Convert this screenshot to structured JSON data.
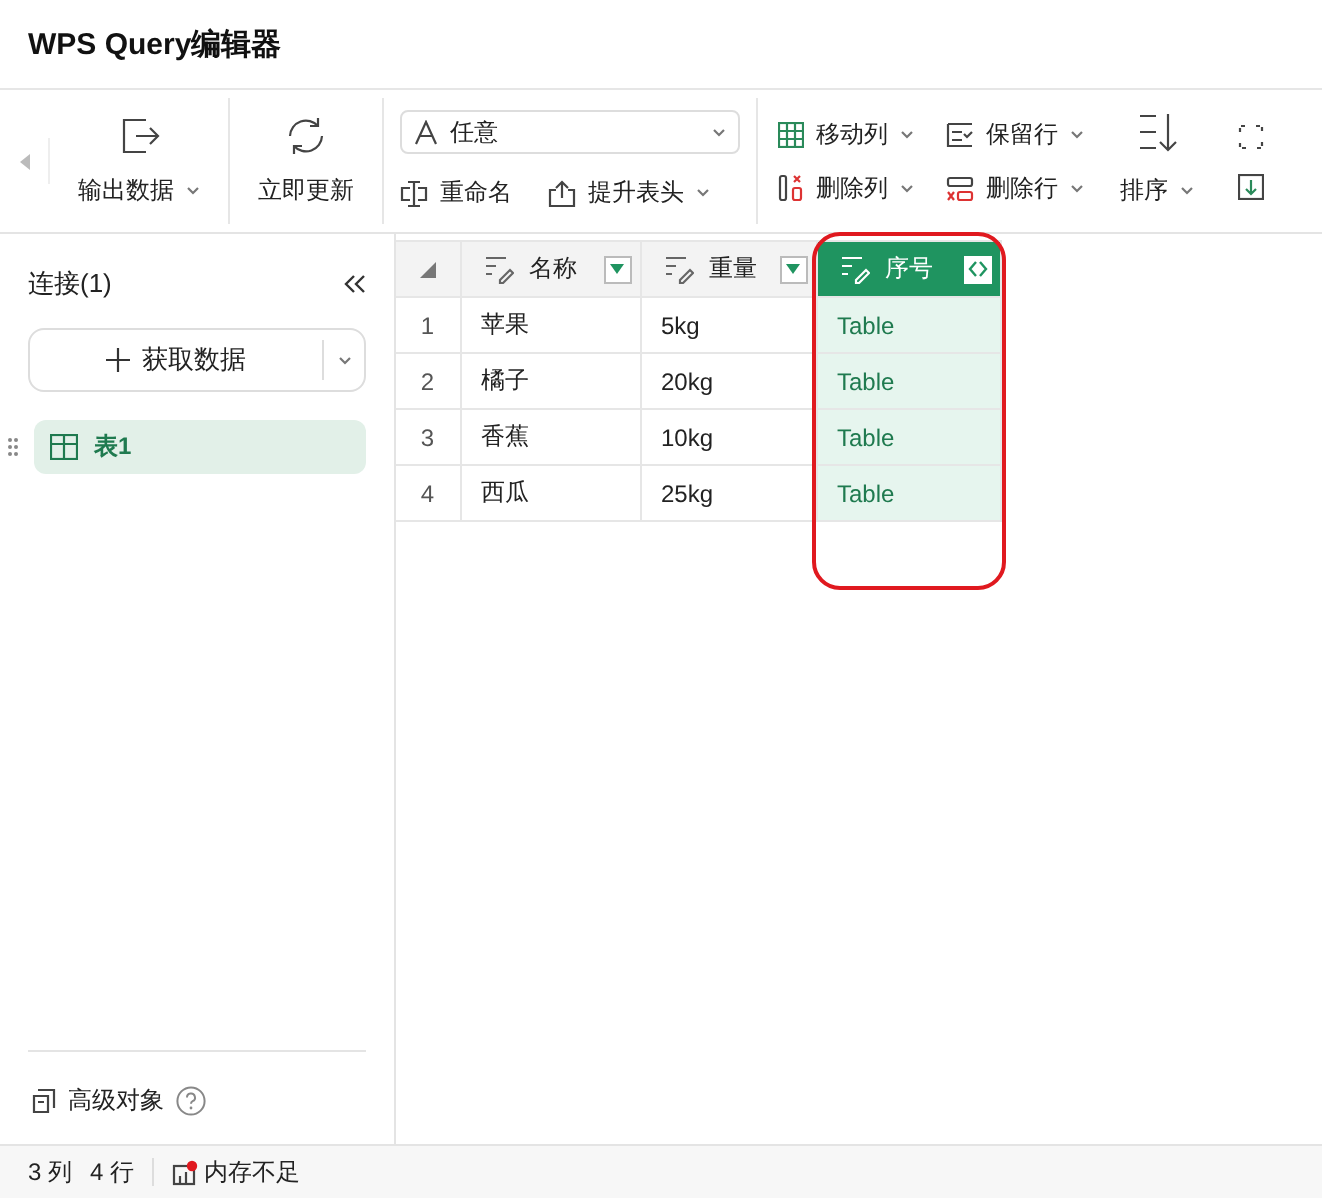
{
  "window": {
    "title": "WPS Query编辑器"
  },
  "toolbar": {
    "export": {
      "label": "输出数据",
      "caret": true
    },
    "refresh": {
      "label": "立即更新"
    },
    "type_select": {
      "value": "任意"
    },
    "small_buttons": [
      {
        "label": "重命名",
        "caret": false
      },
      {
        "label": "提升表头",
        "caret": true
      }
    ],
    "grid_buttons": [
      {
        "label": "移动列",
        "caret": true
      },
      {
        "label": "保留行",
        "caret": true
      },
      {
        "label": "删除列",
        "caret": true
      },
      {
        "label": "删除行",
        "caret": true
      }
    ],
    "sort": {
      "label": "排序",
      "caret": true
    }
  },
  "sidebar": {
    "heading": "连接(1)",
    "get_data": {
      "label": "获取数据"
    },
    "queries": [
      {
        "name": "表1",
        "selected": true
      }
    ],
    "footer": {
      "label": "高级对象"
    }
  },
  "table": {
    "columns": [
      {
        "name": "名称",
        "selected": false,
        "kind": "filter",
        "highlighted": false
      },
      {
        "name": "重量",
        "selected": false,
        "kind": "filter",
        "highlighted": false
      },
      {
        "name": "序号",
        "selected": true,
        "kind": "expand",
        "highlighted": true
      }
    ],
    "rows": [
      {
        "number": "1",
        "cells": [
          "苹果",
          "5kg",
          "Table"
        ]
      },
      {
        "number": "2",
        "cells": [
          "橘子",
          "20kg",
          "Table"
        ]
      },
      {
        "number": "3",
        "cells": [
          "香蕉",
          "10kg",
          "Table"
        ]
      },
      {
        "number": "4",
        "cells": [
          "西瓜",
          "25kg",
          "Table"
        ]
      }
    ]
  },
  "status_bar": {
    "columns": "3 列",
    "rows": "4 行",
    "memory": "内存不足",
    "memory_warning": true
  }
}
